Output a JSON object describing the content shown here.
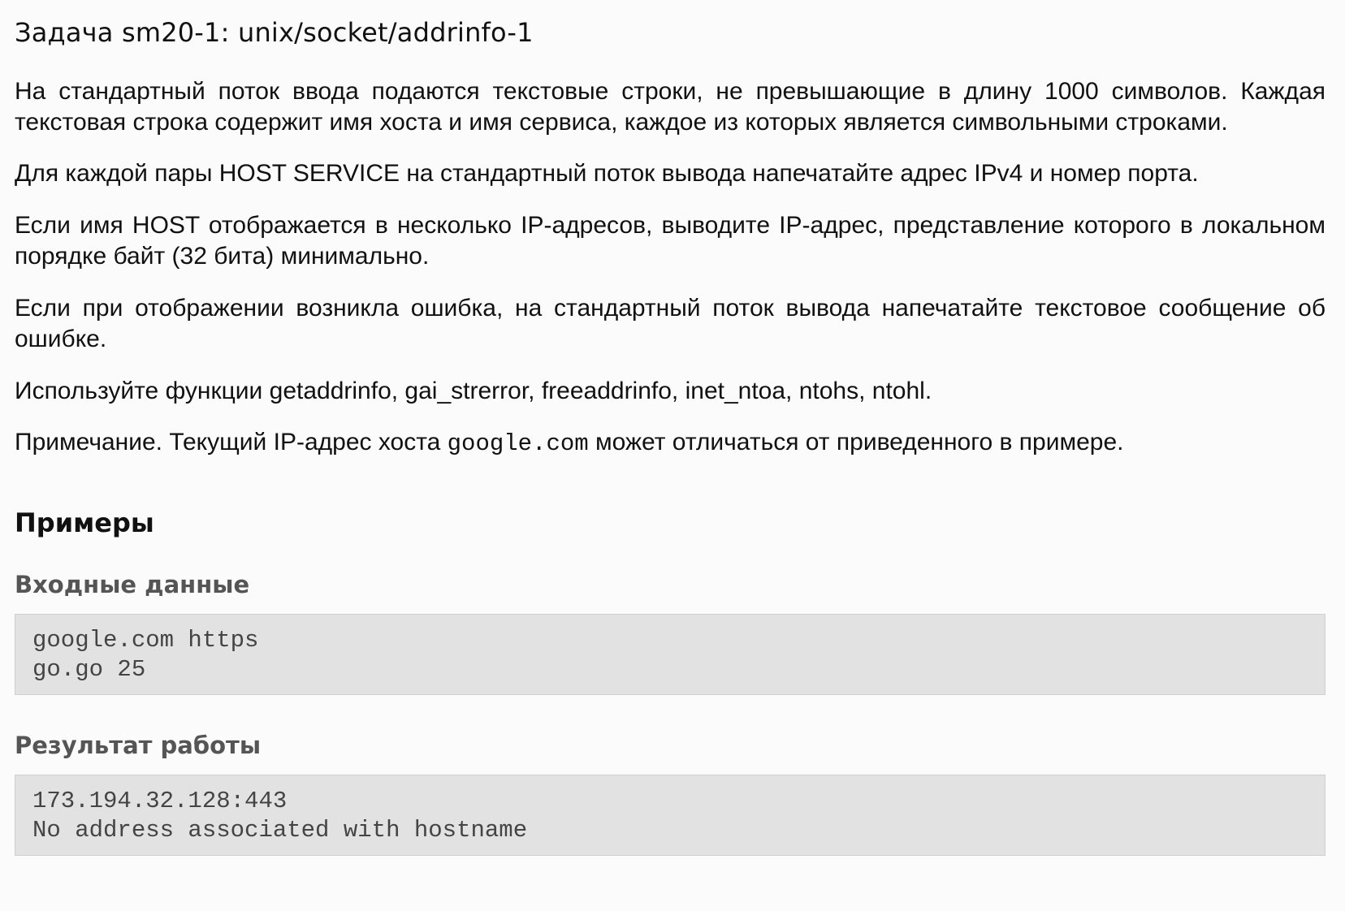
{
  "task": {
    "title": "Задача sm20-1: unix/socket/addrinfo-1"
  },
  "statement": {
    "p1": "На стандартный поток ввода подаются текстовые строки, не превышающие в длину 1000 символов. Каждая текстовая строка содержит имя хоста и имя сервиса, каждое из которых является символьными строками.",
    "p2": "Для каждой пары HOST SERVICE на стандартный поток вывода напечатайте адрес IPv4 и номер порта.",
    "p3": "Если имя HOST отображается в несколько IP-адресов, выводите IP-адрес, представление которого в локальном порядке байт (32 бита) минимально.",
    "p4": "Если при отображении возникла ошибка, на стандартный поток вывода напечатайте текстовое сообщение об ошибке.",
    "p5": "Используйте функции getaddrinfo, gai_strerror, freeaddrinfo, inet_ntoa, ntohs, ntohl.",
    "note_before": "Примечание. Текущий IP-адрес хоста ",
    "note_code": "google.com",
    "note_after": " может отличаться от приведенного в примере."
  },
  "examples": {
    "heading": "Примеры",
    "input_label": "Входные данные",
    "input_lines": [
      "google.com https",
      "go.go 25"
    ],
    "output_label": "Результат работы",
    "output_lines": [
      "173.194.32.128:443",
      "No address associated with hostname"
    ]
  }
}
